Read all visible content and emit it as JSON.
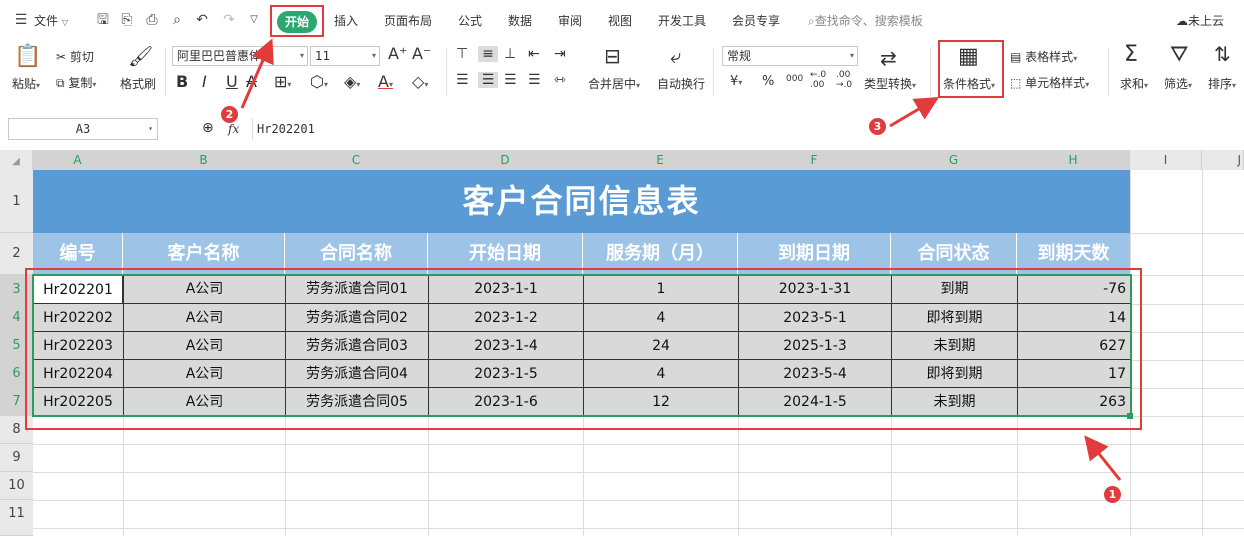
{
  "menubar": {
    "file_label": "文件",
    "tabs": [
      "开始",
      "插入",
      "页面布局",
      "公式",
      "数据",
      "审阅",
      "视图",
      "开发工具",
      "会员专享"
    ],
    "search_placeholder": "查找命令、搜索模板",
    "cloud_label": "未上云"
  },
  "ribbon": {
    "paste": "粘贴",
    "cut": "剪切",
    "copy": "复制",
    "format_painter": "格式刷",
    "font_name": "阿里巴巴普惠体",
    "font_size": "11",
    "merge_center": "合并居中",
    "wrap_text": "自动换行",
    "number_format": "常规",
    "type_convert": "类型转换",
    "conditional_format": "条件格式",
    "table_style": "表格样式",
    "cell_style": "单元格样式",
    "sum": "求和",
    "filter": "筛选",
    "sort": "排序",
    "currency_symbol": "¥",
    "percent_symbol": "%",
    "thousands_symbol": "000",
    "inc_decimal": "←.0 .00",
    "dec_decimal": ".00 →.0"
  },
  "formula_bar": {
    "name_box": "A3",
    "fx": "fx",
    "content": "Hr202201"
  },
  "columns": [
    "A",
    "B",
    "C",
    "D",
    "E",
    "F",
    "G",
    "H",
    "I",
    "J"
  ],
  "rows": [
    "1",
    "2",
    "3",
    "4",
    "5",
    "6",
    "7",
    "8",
    "9",
    "10",
    "11"
  ],
  "sheet": {
    "title": "客户合同信息表",
    "headers": [
      "编号",
      "客户名称",
      "合同名称",
      "开始日期",
      "服务期（月）",
      "到期日期",
      "合同状态",
      "到期天数"
    ],
    "records": [
      [
        "Hr202201",
        "A公司",
        "劳务派遣合同01",
        "2023-1-1",
        "1",
        "2023-1-31",
        "到期",
        "-76"
      ],
      [
        "Hr202202",
        "A公司",
        "劳务派遣合同02",
        "2023-1-2",
        "4",
        "2023-5-1",
        "即将到期",
        "14"
      ],
      [
        "Hr202203",
        "A公司",
        "劳务派遣合同03",
        "2023-1-4",
        "24",
        "2025-1-3",
        "未到期",
        "627"
      ],
      [
        "Hr202204",
        "A公司",
        "劳务派遣合同04",
        "2023-1-5",
        "4",
        "2023-5-4",
        "即将到期",
        "17"
      ],
      [
        "Hr202205",
        "A公司",
        "劳务派遣合同05",
        "2023-1-6",
        "12",
        "2024-1-5",
        "未到期",
        "263"
      ]
    ]
  },
  "annotations": {
    "badge1": "1",
    "badge2": "2",
    "badge3": "3"
  },
  "colors": {
    "accent_green": "#2aa870",
    "title_fill": "#5b9bd5",
    "header_fill": "#9dc3e6",
    "data_fill": "#d9d9d9",
    "annotation_red": "#e23b3b"
  }
}
